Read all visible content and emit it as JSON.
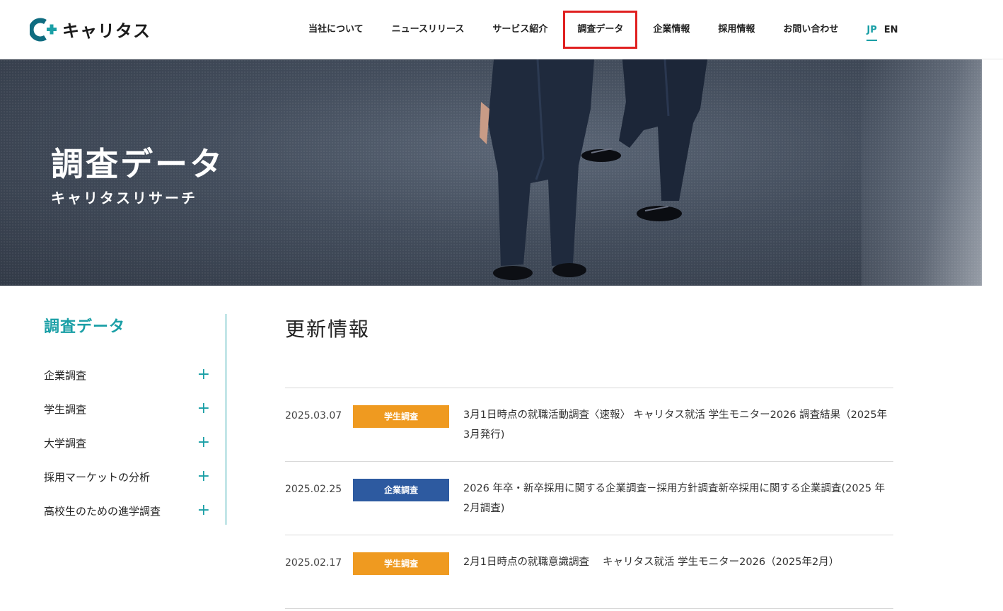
{
  "brand": {
    "name": "キャリタス",
    "accent": "#1a9fa6",
    "logo_mark_color": "#0f6c80"
  },
  "nav": {
    "items": [
      {
        "label": "当社について",
        "active": false
      },
      {
        "label": "ニュースリリース",
        "active": false
      },
      {
        "label": "サービス紹介",
        "active": false
      },
      {
        "label": "調査データ",
        "active": true
      },
      {
        "label": "企業情報",
        "active": false
      },
      {
        "label": "採用情報",
        "active": false
      },
      {
        "label": "お問い合わせ",
        "active": false
      }
    ],
    "lang_jp": "JP",
    "lang_en": "EN"
  },
  "hero": {
    "title": "調査データ",
    "subtitle": "キャリタスリサーチ"
  },
  "sidebar": {
    "title": "調査データ",
    "items": [
      {
        "label": "企業調査",
        "icon": "plus-icon"
      },
      {
        "label": "学生調査",
        "icon": "plus-icon"
      },
      {
        "label": "大学調査",
        "icon": "plus-icon"
      },
      {
        "label": "採用マーケットの分析",
        "icon": "plus-icon"
      },
      {
        "label": "高校生のための進学調査",
        "icon": "plus-icon"
      }
    ]
  },
  "main": {
    "title": "更新情報",
    "news": [
      {
        "date": "2025.03.07",
        "category": "学生調査",
        "category_color": "#ef9a20",
        "title": "3月1日時点の就職活動調査〈速報〉 キャリタス就活 学生モニター2026 調査結果（2025年3月発行)"
      },
      {
        "date": "2025.02.25",
        "category": "企業調査",
        "category_color": "#2d5aa0",
        "title": "2026 年卒・新卒採用に関する企業調査－採用方針調査新卒採用に関する企業調査(2025 年 2月調査)"
      },
      {
        "date": "2025.02.17",
        "category": "学生調査",
        "category_color": "#ef9a20",
        "title": "2月1日時点の就職意識調査　 キャリタス就活 学生モニター2026（2025年2月）"
      }
    ]
  }
}
